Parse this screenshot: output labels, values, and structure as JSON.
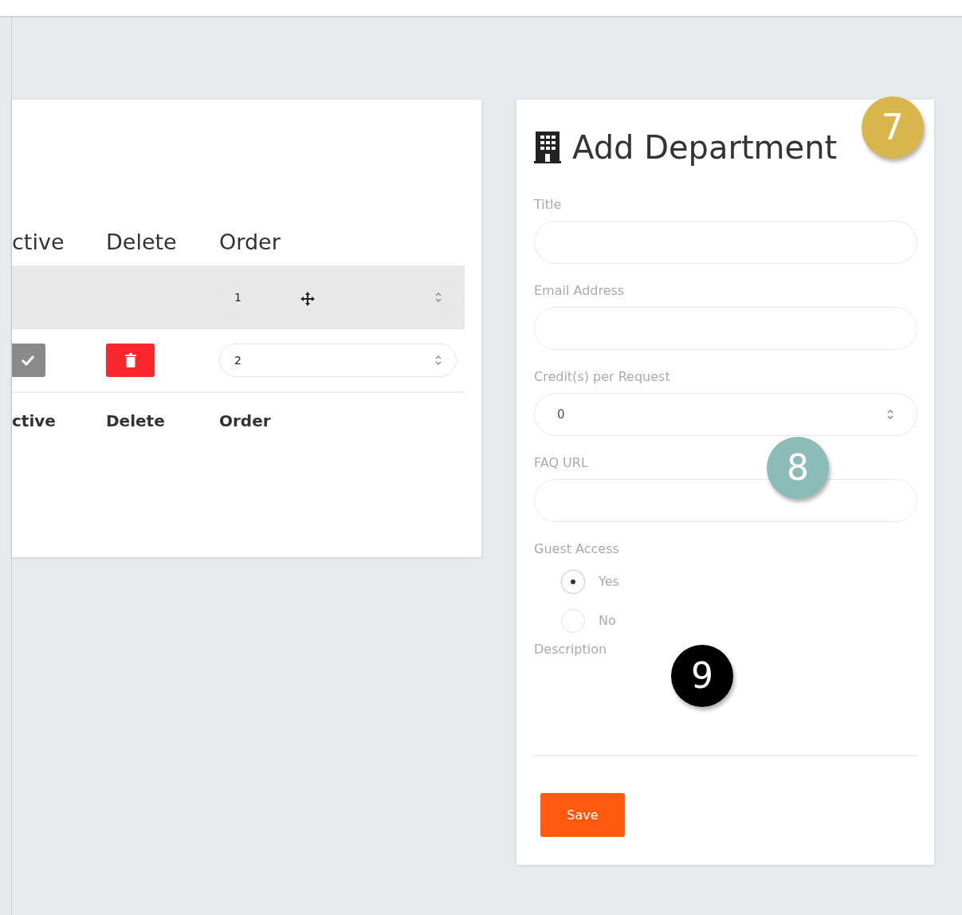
{
  "table": {
    "columns": [
      "ctive",
      "Delete",
      "Order"
    ],
    "rows": [
      {
        "selected": true,
        "dragging": true,
        "order": "1"
      },
      {
        "selected": false,
        "dragging": false,
        "order": "2"
      }
    ],
    "footer": [
      "ctive",
      "Delete",
      "Order"
    ]
  },
  "form": {
    "title": "Add Department",
    "fields": [
      {
        "kind": "text",
        "label": "Title"
      },
      {
        "kind": "text",
        "label": "Email Address"
      },
      {
        "kind": "number",
        "label": "Credit(s) per Request",
        "value": "0"
      },
      {
        "kind": "text",
        "label": "FAQ URL"
      },
      {
        "kind": "radio",
        "label": "Guest Access",
        "options": [
          {
            "label": "Yes",
            "selected": true
          },
          {
            "label": "No",
            "selected": false
          }
        ]
      },
      {
        "kind": "textarea",
        "label": "Description"
      }
    ],
    "save": "Save"
  },
  "callouts": [
    {
      "label": "7",
      "color": "#d9b64c"
    },
    {
      "label": "8",
      "color": "#8bbcb8"
    },
    {
      "label": "9",
      "color": "#000000"
    }
  ]
}
